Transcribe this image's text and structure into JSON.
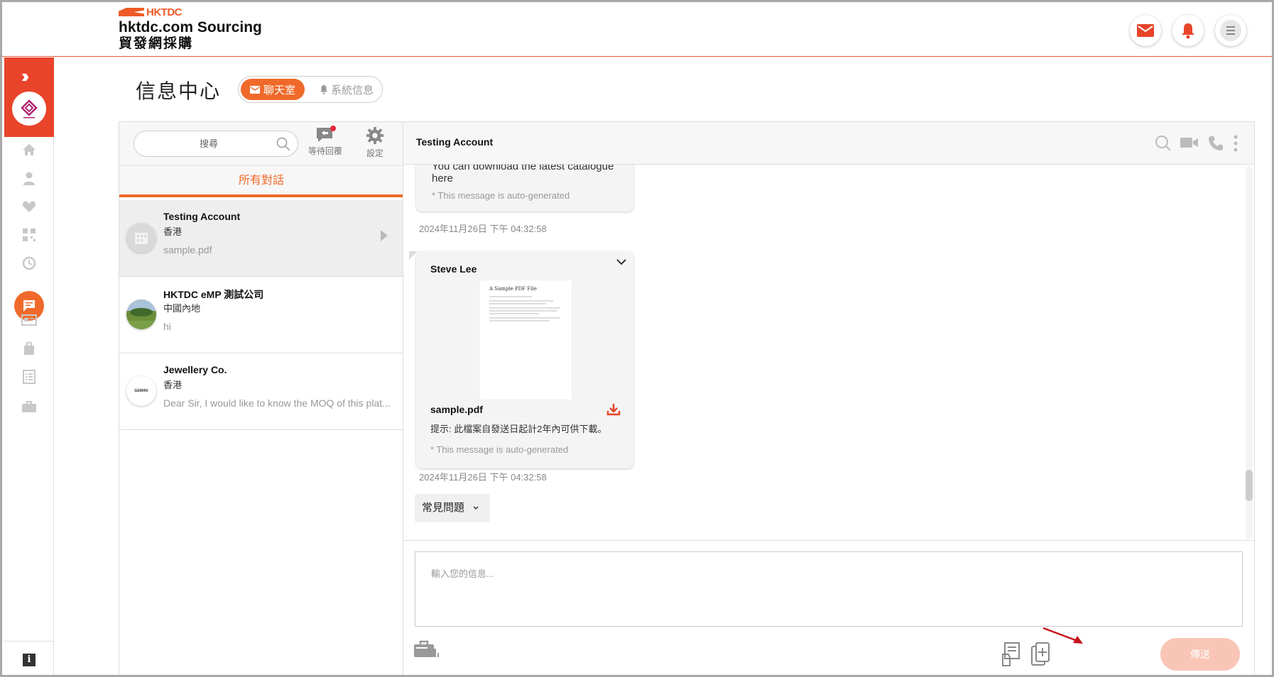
{
  "header": {
    "logo_mark": "HKTDC",
    "brand_en": "hktdc.com Sourcing",
    "brand_zh": "貿發網採購"
  },
  "sidebar": {
    "expand_icon": "double-chevron-right-icon",
    "avatar_alt": "company-logo",
    "items": [
      "home-icon",
      "profile-icon",
      "favorites-icon",
      "qr-code-icon",
      "history-icon",
      "chat-icon",
      "card-icon",
      "bag-icon",
      "list-icon",
      "briefcase-icon"
    ],
    "active_index": 5,
    "info_label": "i"
  },
  "page": {
    "title": "信息中心",
    "tabs": [
      {
        "label": "聊天室",
        "icon": "mail-icon",
        "active": true
      },
      {
        "label": "系統信息",
        "icon": "bell-icon",
        "active": false
      }
    ]
  },
  "list_panel": {
    "search_placeholder": "搜尋",
    "pending_label": "等待回覆",
    "settings_label": "設定",
    "tab_all": "所有對話",
    "conversations": [
      {
        "name": "Testing Account",
        "location": "香港",
        "last_message": "sample.pdf",
        "selected": true
      },
      {
        "name": "HKTDC eMP 測試公司",
        "location": "中國內地",
        "last_message": "hi",
        "selected": false
      },
      {
        "name": "Jewellery Co.",
        "location": "香港",
        "last_message": "Dear Sir, I would like to know the MOQ of this plat...",
        "selected": false,
        "avatar_text": "GEMINI"
      }
    ]
  },
  "chat": {
    "contact_name": "Testing Account",
    "messages": [
      {
        "text": "You can download the latest catalogue here",
        "auto_note": "* This message is auto-generated",
        "timestamp": "2024年11月26日 下午 04:32:58"
      },
      {
        "sender": "Steve Lee",
        "file_name": "sample.pdf",
        "pdf_title": "A Sample PDF File",
        "hint": "提示: 此檔案自發送日起計2年內可供下載。",
        "auto_note": "* This message is auto-generated",
        "timestamp": "2024年11月26日 下午 04:32:58"
      }
    ],
    "faq_label": "常見問題",
    "input_placeholder": "輸入您的信息...",
    "send_label": "傳送"
  },
  "colors": {
    "accent": "#ef6a2a",
    "brand_red": "#e8442a",
    "send_disabled": "#f9c5b6"
  }
}
